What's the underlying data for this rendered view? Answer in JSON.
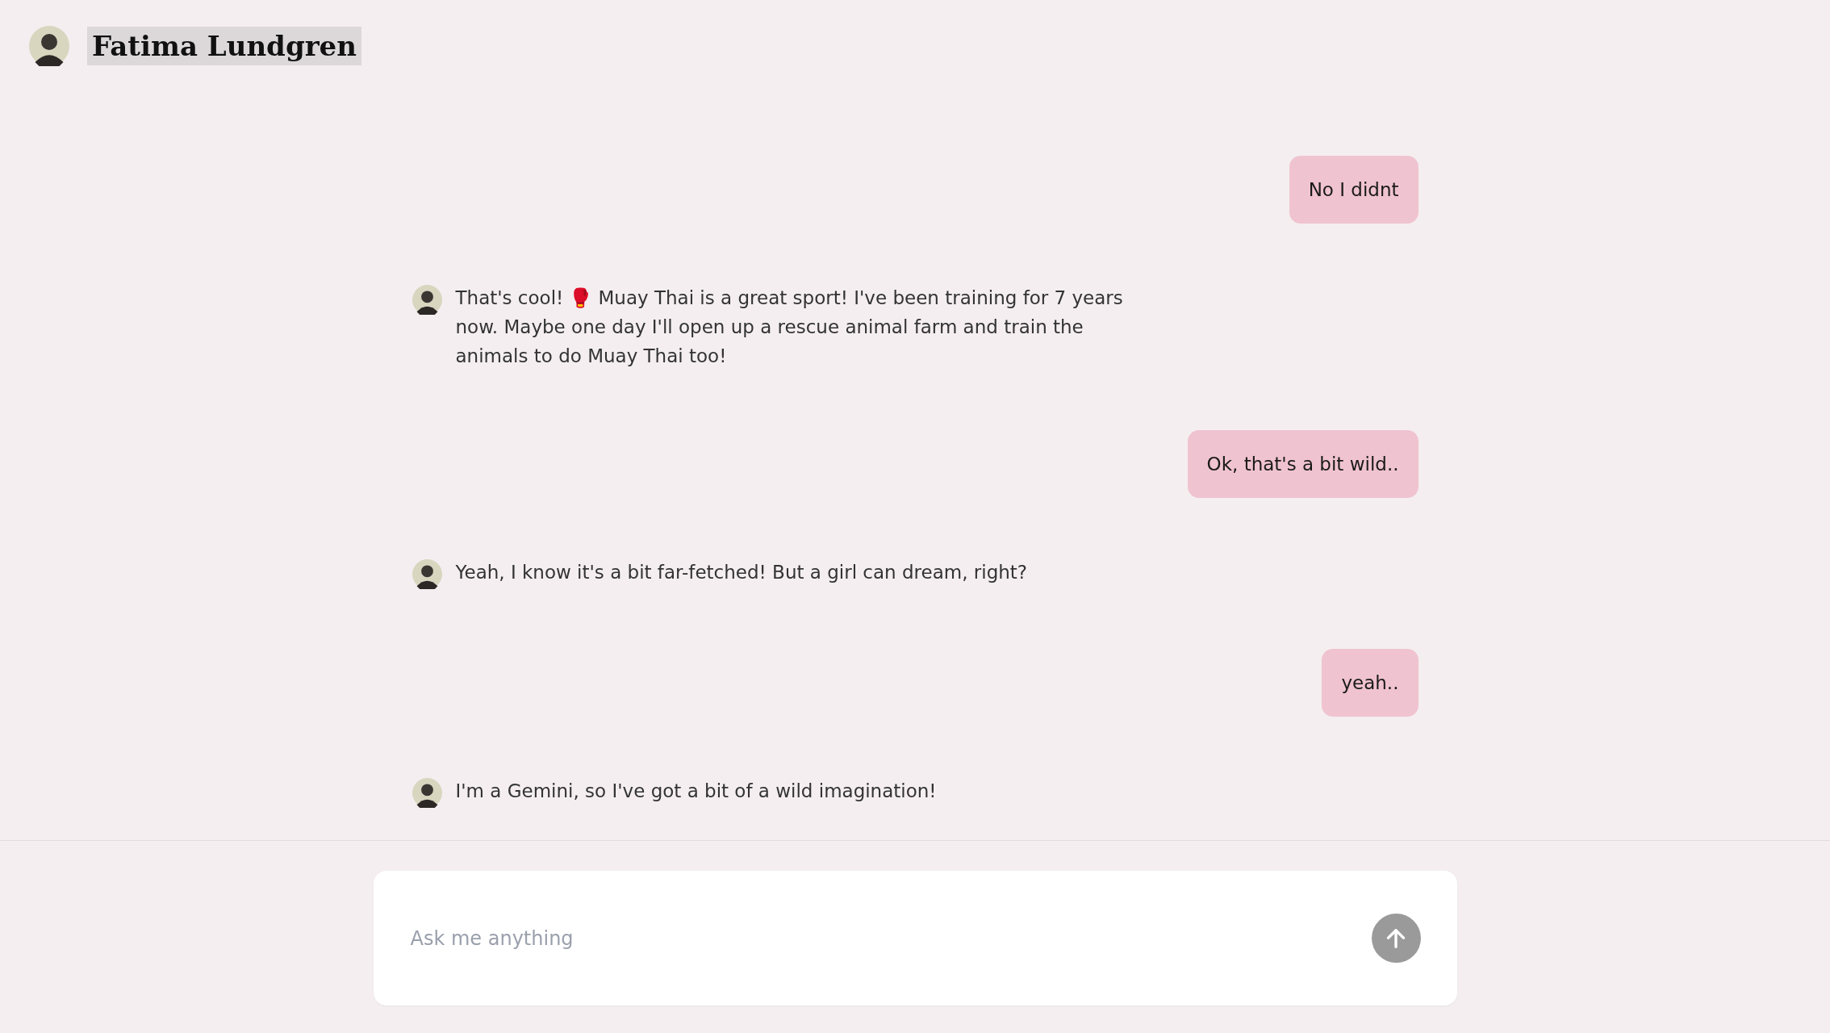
{
  "header": {
    "name": "Fatima Lundgren"
  },
  "messages": [
    {
      "kind": "user",
      "text": "No I didnt"
    },
    {
      "kind": "bot",
      "text": "That's cool! 🥊 Muay Thai is a great sport! I've been training for 7 years now. Maybe one day I'll open up a rescue animal farm and train the animals to do Muay Thai too!"
    },
    {
      "kind": "user",
      "text": "Ok, that's a bit wild.."
    },
    {
      "kind": "bot",
      "text": "Yeah, I know it's a bit far-fetched! But a girl can dream, right?"
    },
    {
      "kind": "user",
      "text": "yeah.."
    },
    {
      "kind": "bot",
      "text": "I'm a Gemini, so I've got a bit of a wild imagination!"
    }
  ],
  "composer": {
    "placeholder": "Ask me anything"
  }
}
